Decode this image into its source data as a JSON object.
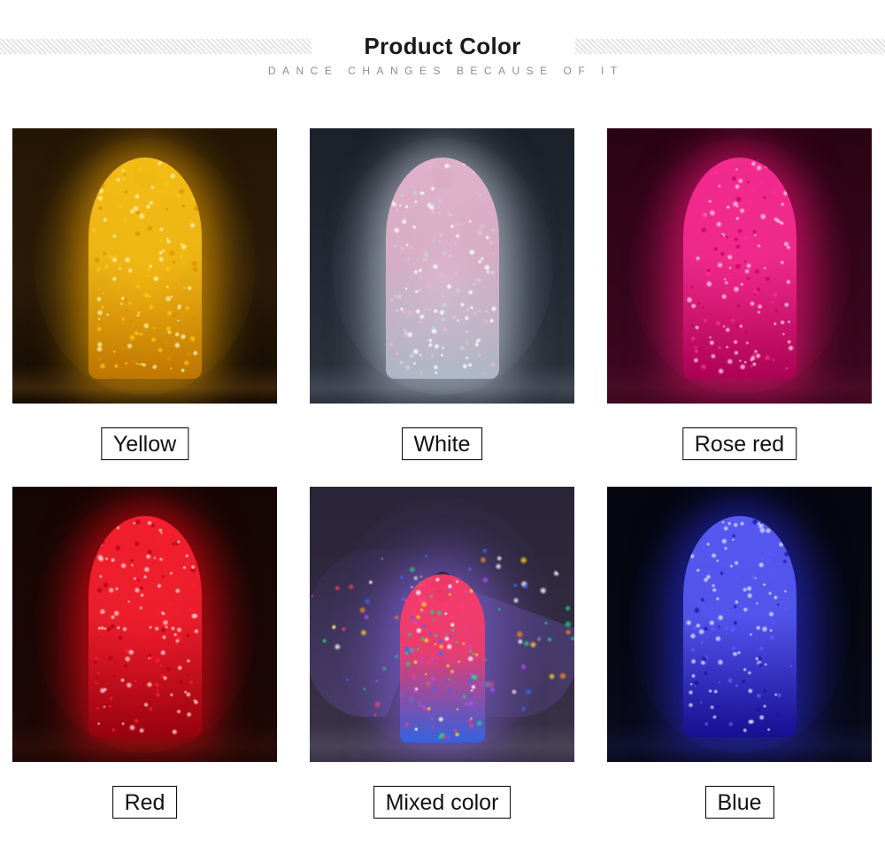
{
  "header": {
    "title": "Product Color",
    "subtitle": "DANCE CHANGES BECAUSE OF IT",
    "decoration_left": "diagonal-stripe-band",
    "decoration_right": "diagonal-stripe-band",
    "title_color": "#1a1a1a",
    "subtitle_color": "#8c8c8c",
    "stripe_color": "#e3e3e3"
  },
  "gallery": {
    "columns": 3,
    "rows": 2,
    "items": [
      {
        "label": "Yellow",
        "alt": "led-cape-yellow-photo",
        "swatch": "#ffc21a",
        "led_core": "#fff3b0",
        "led_mid": "#ffc515",
        "led_edge": "#e08900",
        "bg_top": "#241605",
        "bg_bottom": "#120a03",
        "wall": "#2a1a07",
        "floor": "#3a250c",
        "glow": "#ffae00"
      },
      {
        "label": "White",
        "alt": "led-cape-white-photo",
        "swatch": "#f0f2f6",
        "led_core": "#ffffff",
        "led_mid": "#e9b9d2",
        "led_edge": "#c9d3e2",
        "bg_top": "#1b2029",
        "bg_bottom": "#2c333d",
        "wall": "#232a35",
        "floor": "#404854",
        "glow": "#cfd8e6"
      },
      {
        "label": "Rose red",
        "alt": "led-cape-rose-red-photo",
        "swatch": "#ff1f8f",
        "led_core": "#ffd0e8",
        "led_mid": "#ff2d95",
        "led_edge": "#c1005f",
        "bg_top": "#2a0312",
        "bg_bottom": "#3d0820",
        "wall": "#35061a",
        "floor": "#4a0c25",
        "glow": "#ff1680"
      },
      {
        "label": "Red",
        "alt": "led-cape-red-photo",
        "swatch": "#ff1020",
        "led_core": "#ffd2d2",
        "led_mid": "#ff2030",
        "led_edge": "#b00010",
        "bg_top": "#150604",
        "bg_bottom": "#1d0806",
        "wall": "#190705",
        "floor": "#2a0d08",
        "glow": "#ff0a18"
      },
      {
        "label": "Mixed color",
        "alt": "led-isis-wings-mixed-color-photo",
        "swatch": "#9b4fd0",
        "led_core": "#ffffff",
        "led_mid": "#ff3b6b",
        "led_edge": "#2f6bff",
        "bg_top": "#2a2438",
        "bg_bottom": "#3a3348",
        "wall": "#322b42",
        "floor": "#4a4358",
        "glow": "#7a5fd0"
      },
      {
        "label": "Blue",
        "alt": "led-cape-blue-photo",
        "swatch": "#2a2bff",
        "led_core": "#dfe4ff",
        "led_mid": "#5a5cff",
        "led_edge": "#1a0fa8",
        "bg_top": "#05060f",
        "bg_bottom": "#0a0b1c",
        "wall": "#070813",
        "floor": "#101230",
        "glow": "#2b2ee0"
      }
    ]
  }
}
